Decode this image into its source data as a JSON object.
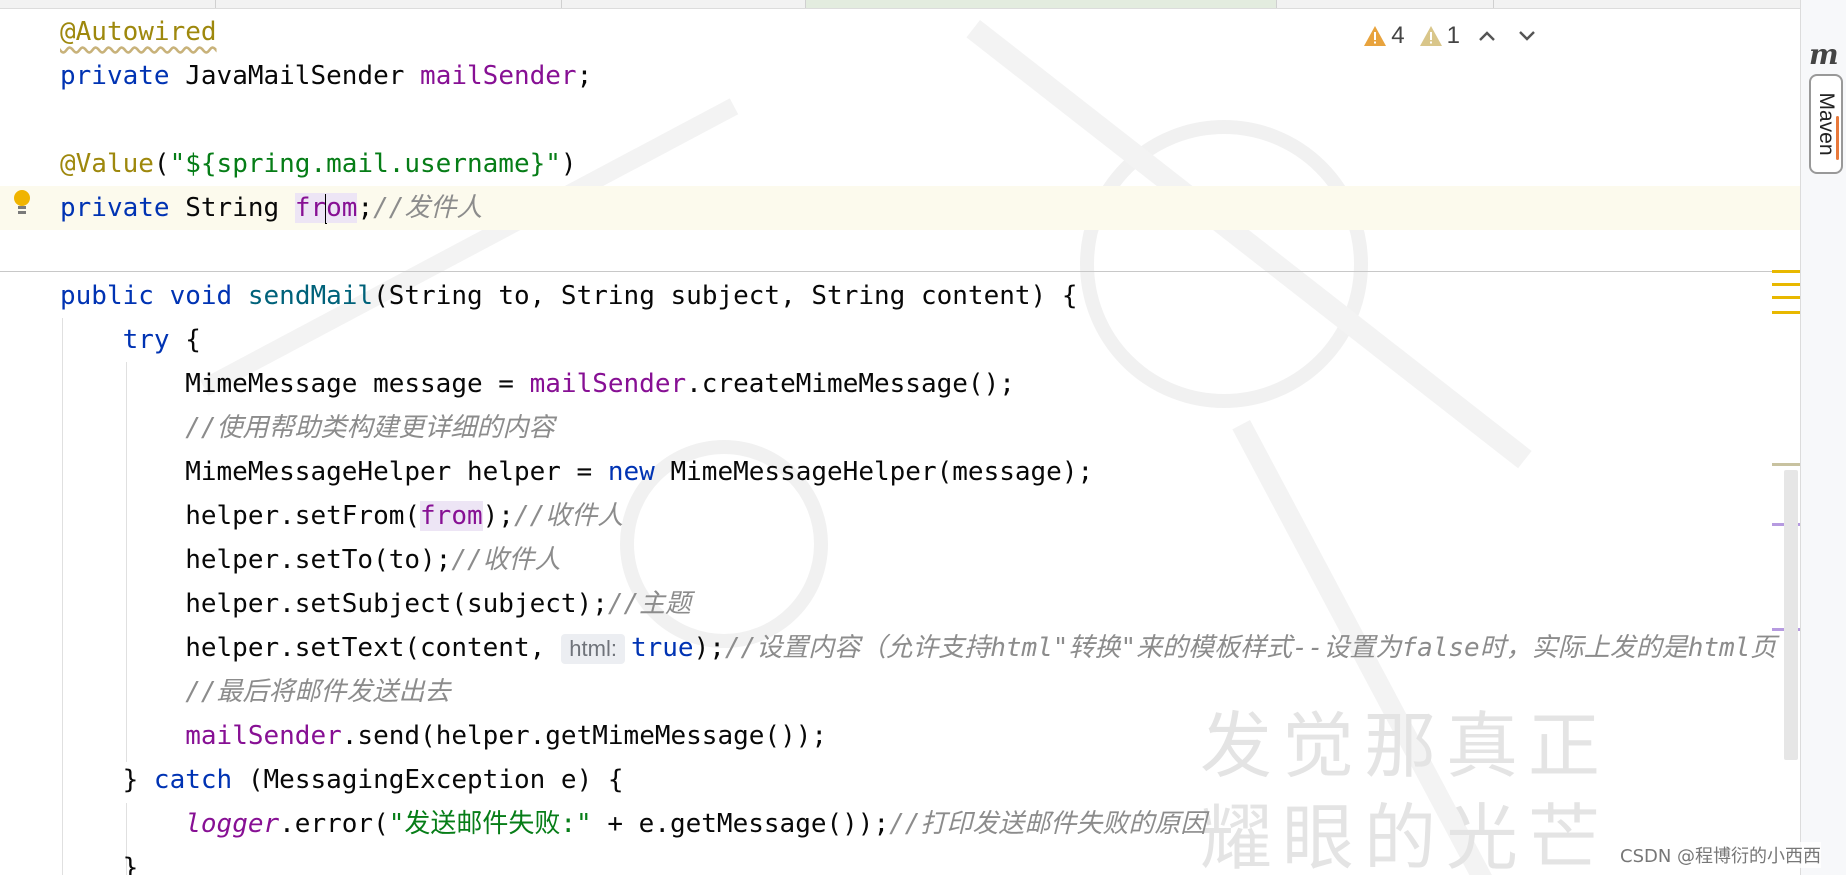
{
  "editor": {
    "lines": [
      {
        "tokens": [
          {
            "t": "@Autowired",
            "c": "ann squiggle"
          }
        ]
      },
      {
        "tokens": [
          {
            "t": "private ",
            "c": "kw"
          },
          {
            "t": "JavaMailSender ",
            "c": ""
          },
          {
            "t": "mailSender",
            "c": "fld"
          },
          {
            "t": ";",
            "c": ""
          }
        ]
      },
      {
        "tokens": []
      },
      {
        "tokens": [
          {
            "t": "@Value",
            "c": "ann"
          },
          {
            "t": "(",
            "c": ""
          },
          {
            "t": "\"${spring.mail.username}\"",
            "c": "str"
          },
          {
            "t": ")",
            "c": ""
          }
        ]
      },
      {
        "tokens": [
          {
            "t": "private ",
            "c": "kw"
          },
          {
            "t": "String ",
            "c": ""
          },
          {
            "t": "fr",
            "c": "fld hl-usage"
          },
          {
            "caret": true
          },
          {
            "t": "om",
            "c": "fld hl-usage"
          },
          {
            "t": ";",
            "c": ""
          },
          {
            "t": "//发件人",
            "c": "cmt"
          }
        ]
      },
      {
        "tokens": []
      },
      {
        "tokens": [
          {
            "t": "public ",
            "c": "kw"
          },
          {
            "t": "void ",
            "c": "kw"
          },
          {
            "t": "sendMail",
            "c": "mth"
          },
          {
            "t": "(String to, String subject, String content) {",
            "c": ""
          }
        ]
      },
      {
        "tokens": [
          {
            "t": "    ",
            "c": ""
          },
          {
            "t": "try",
            "c": "kw"
          },
          {
            "t": " {",
            "c": ""
          }
        ]
      },
      {
        "tokens": [
          {
            "t": "        MimeMessage message = ",
            "c": ""
          },
          {
            "t": "mailSender",
            "c": "fld"
          },
          {
            "t": ".createMimeMessage();",
            "c": ""
          }
        ]
      },
      {
        "tokens": [
          {
            "t": "        ",
            "c": ""
          },
          {
            "t": "//使用帮助类构建更详细的内容",
            "c": "cmt"
          }
        ]
      },
      {
        "tokens": [
          {
            "t": "        MimeMessageHelper helper = ",
            "c": ""
          },
          {
            "t": "new",
            "c": "kw"
          },
          {
            "t": " MimeMessageHelper(message);",
            "c": ""
          }
        ]
      },
      {
        "tokens": [
          {
            "t": "        helper.setFrom(",
            "c": ""
          },
          {
            "t": "from",
            "c": "fld hl-usage"
          },
          {
            "t": ");",
            "c": ""
          },
          {
            "t": "//收件人",
            "c": "cmt"
          }
        ]
      },
      {
        "tokens": [
          {
            "t": "        helper.setTo(to);",
            "c": ""
          },
          {
            "t": "//收件人",
            "c": "cmt"
          }
        ]
      },
      {
        "tokens": [
          {
            "t": "        helper.setSubject(subject);",
            "c": ""
          },
          {
            "t": "//主题",
            "c": "cmt"
          }
        ]
      },
      {
        "tokens": [
          {
            "t": "        helper.setText(content,",
            "c": ""
          },
          {
            "hint": "html:"
          },
          {
            "t": "true",
            "c": "kw"
          },
          {
            "t": ");",
            "c": ""
          },
          {
            "t": "//设置内容（允许支持html\"转换\"来的模板样式--设置为false时，实际上发的是html页",
            "c": "cmt"
          }
        ]
      },
      {
        "tokens": [
          {
            "t": "        ",
            "c": ""
          },
          {
            "t": "//最后将邮件发送出去",
            "c": "cmt"
          }
        ]
      },
      {
        "tokens": [
          {
            "t": "        ",
            "c": ""
          },
          {
            "t": "mailSender",
            "c": "fld"
          },
          {
            "t": ".send(helper.getMimeMessage());",
            "c": ""
          }
        ]
      },
      {
        "tokens": [
          {
            "t": "    } ",
            "c": ""
          },
          {
            "t": "catch",
            "c": "kw"
          },
          {
            "t": " (MessagingException e) {",
            "c": ""
          }
        ]
      },
      {
        "tokens": [
          {
            "t": "        ",
            "c": ""
          },
          {
            "t": "logger",
            "c": "stat"
          },
          {
            "t": ".error(",
            "c": ""
          },
          {
            "t": "\"发送邮件失败:\"",
            "c": "str"
          },
          {
            "t": " + e.getMessage());",
            "c": ""
          },
          {
            "t": "//打印发送邮件失败的原因",
            "c": "cmt"
          }
        ]
      },
      {
        "tokens": [
          {
            "t": "    }",
            "c": ""
          }
        ]
      }
    ]
  },
  "inspections": {
    "warnings_count": "4",
    "weak_warnings_count": "1",
    "warning_color": "#e8a33d",
    "weak_warning_color": "#d9c68a"
  },
  "right_panel": {
    "logo": "m",
    "tab_label": "Maven"
  },
  "watermark": {
    "line1": "发觉那真正",
    "line2": "耀眼的光芒"
  },
  "credit": "CSDN @程博衍的小西西",
  "colors": {
    "keyword": "#0033b3",
    "annotation": "#9e880d",
    "field": "#871094",
    "string": "#067d17",
    "comment": "#8c8c8c",
    "method": "#00627a",
    "current_line": "#fcfaed"
  }
}
